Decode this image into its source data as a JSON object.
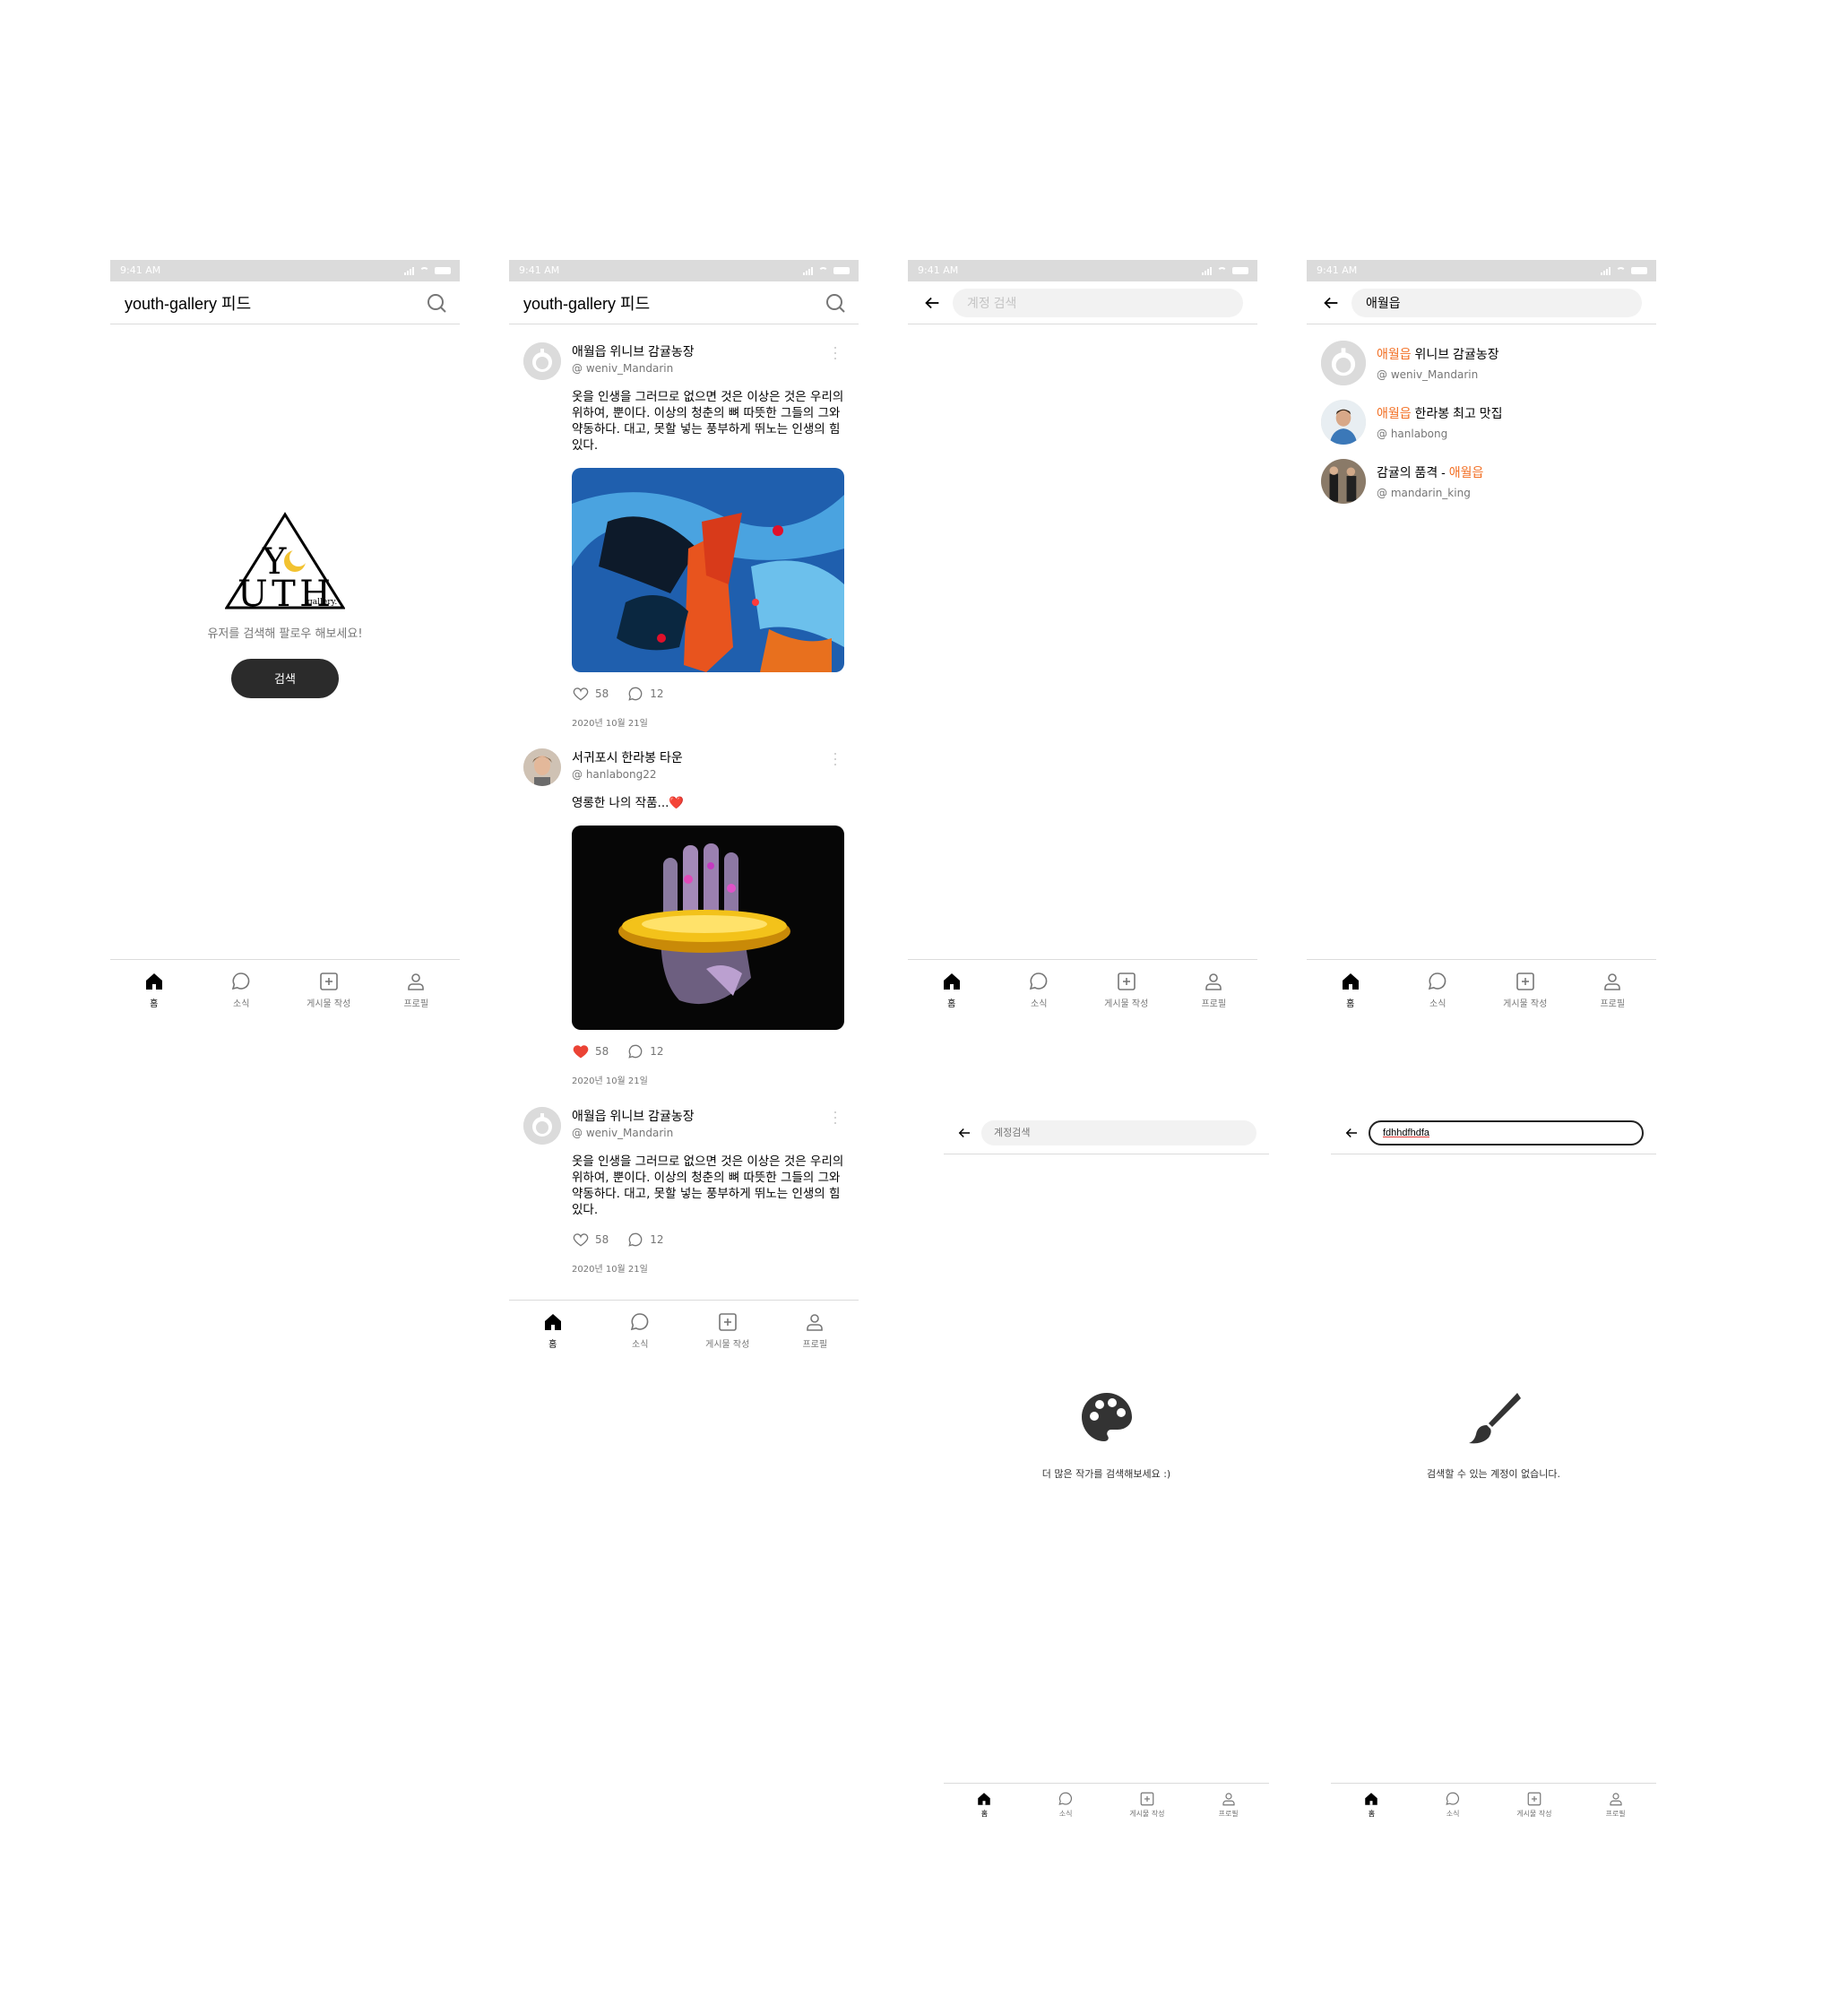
{
  "status": {
    "time": "9:41 AM"
  },
  "feed_header": {
    "title": "youth-gallery 피드"
  },
  "empty_feed": {
    "message": "유저를 검색해 팔로우 해보세요!",
    "button": "검색",
    "logo_text": "YOUTH gallery."
  },
  "tabs": [
    {
      "label": "홈",
      "icon": "home-icon"
    },
    {
      "label": "소식",
      "icon": "chat-icon"
    },
    {
      "label": "게시물 작성",
      "icon": "plus-square-icon"
    },
    {
      "label": "프로필",
      "icon": "user-icon"
    }
  ],
  "posts": [
    {
      "name": "애월읍 위니브 감귤농장",
      "id": "@ weniv_Mandarin",
      "text": "옷을 인생을 그러므로 없으면 것은 이상은 것은 우리의 위하여, 뿐이다. 이상의 청춘의 뼈 따뜻한 그들의 그와 약동하다. 대고, 못할 넣는 풍부하게 뛰노는 인생의 힘있다.",
      "likes": "58",
      "comments": "12",
      "date": "2020년 10월 21일",
      "liked": false
    },
    {
      "name": "서귀포시 한라봉 타운",
      "id": "@ hanlabong22",
      "text": "영롱한 나의 작품...❤️",
      "likes": "58",
      "comments": "12",
      "date": "2020년 10월 21일",
      "liked": true
    },
    {
      "name": "애월읍 위니브 감귤농장",
      "id": "@ weniv_Mandarin",
      "text": "옷을 인생을 그러므로 없으면 것은 이상은 것은 우리의 위하여, 뿐이다. 이상의 청춘의 뼈 따뜻한 그들의 그와 약동하다. 대고, 못할 넣는 풍부하게 뛰노는 인생의 힘있다.",
      "likes": "58",
      "comments": "12",
      "date": "2020년 10월 21일",
      "liked": false
    }
  ],
  "search": {
    "placeholder": "계정 검색",
    "query": "애월읍",
    "placeholder_small": "계정검색",
    "typed_value": "fdhhdfhdfa"
  },
  "results": [
    {
      "hl_before": "",
      "hl": "애월읍",
      "rest": " 위니브 감귤농장",
      "id": "@ weniv_Mandarin"
    },
    {
      "hl_before": "",
      "hl": "애월읍",
      "rest": " 한라봉 최고 맛집",
      "id": "@ hanlabong"
    },
    {
      "hl_before": "감귤의 품격 - ",
      "hl": "애월읍",
      "rest": "",
      "id": "@ mandarin_king"
    }
  ],
  "empty_states": {
    "suggest": "더 많은 작가를 검색해보세요 :)",
    "none": "검색할 수 있는 계정이 없습니다."
  },
  "colors": {
    "accent": "#f26e22",
    "like": "#eb4335",
    "border": "#dbdbdb"
  }
}
